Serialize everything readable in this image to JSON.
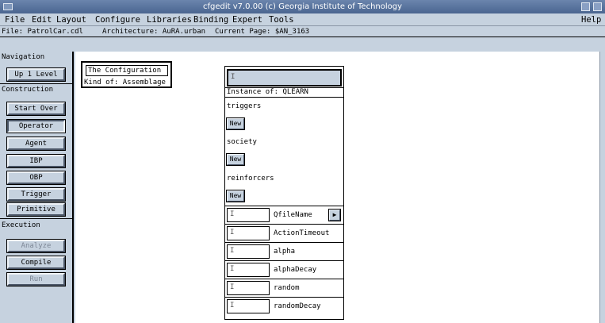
{
  "window": {
    "title": "cfgedit v7.0.00  (c) Georgia Institute of Technology"
  },
  "menubar": {
    "items": [
      {
        "label": "File"
      },
      {
        "label": "Edit"
      },
      {
        "label": "Layout"
      },
      {
        "label": "Configure"
      },
      {
        "label": "Libraries"
      },
      {
        "label": "Binding"
      },
      {
        "label": "Expert"
      },
      {
        "label": "Tools"
      }
    ],
    "help": "Help"
  },
  "infobar": {
    "file": "File:  PatrolCar.cdl",
    "architecture": "Architecture:  AuRA.urban",
    "page": "Current Page:  $AN_3163"
  },
  "sidebar": {
    "navigation_label": "Navigation",
    "up_level": "Up 1 Level",
    "construction_label": "Construction",
    "construction_buttons": [
      "Start Over",
      "Operator",
      "Agent",
      "IBP",
      "OBP",
      "Trigger",
      "Primitive"
    ],
    "execution_label": "Execution",
    "execution_buttons": [
      "Analyze",
      "Compile",
      "Run"
    ]
  },
  "config_box": {
    "title": "The Configuration",
    "kind": "Kind of: Assemblage"
  },
  "instance": {
    "caret": "I",
    "of": "Instance of:  QLEARN",
    "sections": [
      "triggers",
      "society",
      "reinforcers"
    ],
    "new_label": "New",
    "params": [
      "QfileName",
      "ActionTimeout",
      "alpha",
      "alphaDecay",
      "random",
      "randomDecay"
    ],
    "arrow": "▶"
  }
}
